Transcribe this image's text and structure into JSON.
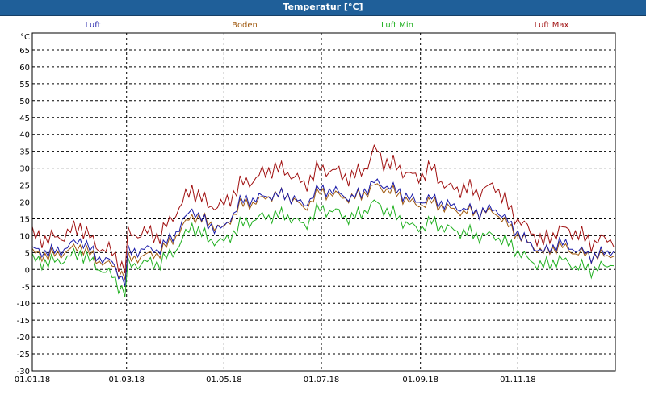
{
  "window": {
    "title": "Temperatur [°C]"
  },
  "colors": {
    "luft": "#1a1aa8",
    "boden": "#a05a10",
    "luft_min": "#20b020",
    "luft_max": "#a01010",
    "grid": "#000000",
    "titlebar": "#1f5f99"
  },
  "chart_data": {
    "type": "line",
    "title": "Temperatur [°C]",
    "ylabel": "°C",
    "xlabel": "",
    "ylim": [
      -30,
      70
    ],
    "xlim": [
      0,
      365
    ],
    "yticks": [
      -30,
      -25,
      -20,
      -15,
      -10,
      -5,
      0,
      5,
      10,
      15,
      20,
      25,
      30,
      35,
      40,
      45,
      50,
      55,
      60,
      65
    ],
    "xticks": [
      {
        "label": "01.01.18",
        "day": 0
      },
      {
        "label": "01.03.18",
        "day": 59
      },
      {
        "label": "01.05.18",
        "day": 120
      },
      {
        "label": "01.07.18",
        "day": 181
      },
      {
        "label": "01.09.18",
        "day": 243
      },
      {
        "label": "01.11.18",
        "day": 304
      }
    ],
    "grid": true,
    "legend_position": "top",
    "x": [
      0,
      10,
      20,
      30,
      40,
      50,
      58,
      60,
      70,
      80,
      90,
      100,
      110,
      120,
      130,
      140,
      150,
      160,
      170,
      180,
      190,
      200,
      210,
      215,
      220,
      230,
      240,
      250,
      260,
      270,
      280,
      290,
      300,
      310,
      320,
      330,
      340,
      350,
      360,
      365
    ],
    "series": [
      {
        "name": "Luft",
        "color_key": "luft",
        "values": [
          6,
          5,
          6,
          9,
          4,
          2,
          -4,
          5,
          6,
          6,
          11,
          18,
          13,
          12,
          20,
          21,
          22,
          22,
          19,
          24,
          23,
          21,
          24,
          26,
          25,
          23,
          20,
          21,
          19,
          18,
          17,
          18,
          13,
          8,
          5,
          8,
          6,
          4,
          5,
          6
        ]
      },
      {
        "name": "Boden",
        "color_key": "boden",
        "values": [
          5,
          4,
          5,
          7,
          3,
          1,
          -2,
          3,
          4,
          5,
          10,
          16,
          14,
          12,
          19,
          20,
          22,
          22,
          18,
          23,
          22,
          21,
          23,
          25,
          24,
          22,
          19,
          20,
          18,
          17,
          17,
          17,
          12,
          8,
          5,
          7,
          5,
          4,
          4,
          5
        ]
      },
      {
        "name": "Luft Min",
        "color_key": "luft_min",
        "values": [
          3,
          2,
          3,
          5,
          1,
          -2,
          -7,
          1,
          2,
          2,
          6,
          13,
          9,
          8,
          13,
          15,
          16,
          16,
          13,
          18,
          17,
          15,
          18,
          20,
          18,
          15,
          12,
          14,
          12,
          11,
          10,
          10,
          7,
          3,
          1,
          3,
          1,
          0,
          1,
          3
        ]
      },
      {
        "name": "Luft Max",
        "color_key": "luft_max",
        "values": [
          10,
          9,
          10,
          13,
          7,
          5,
          0,
          10,
          11,
          10,
          17,
          24,
          19,
          19,
          25,
          27,
          30,
          29,
          25,
          30,
          29,
          27,
          31,
          36,
          32,
          30,
          27,
          30,
          24,
          24,
          23,
          25,
          17,
          12,
          8,
          12,
          11,
          8,
          9,
          9
        ]
      }
    ]
  }
}
